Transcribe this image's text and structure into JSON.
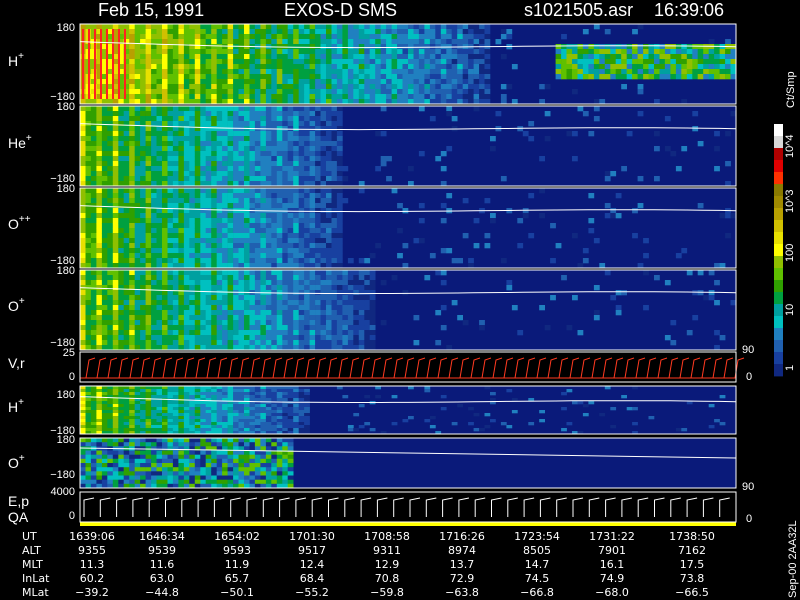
{
  "header": {
    "date": "Feb 15, 1991",
    "mission": "EXOS-D SMS",
    "file": "s1021505.asr",
    "time": "16:39:06"
  },
  "colorbar": {
    "unit": "Ct/Smp",
    "tick_labels": [
      "10^4",
      "10^3",
      "100",
      "10",
      "1"
    ],
    "colors": [
      "#ffffff",
      "#d8d8d8",
      "#b00000",
      "#e00000",
      "#ff3000",
      "#8a7a00",
      "#a08a00",
      "#b8a000",
      "#d0c000",
      "#e8e000",
      "#ffff00",
      "#90c000",
      "#60c000",
      "#30a000",
      "#00a040",
      "#00a0a0",
      "#00c0c0",
      "#2080c0",
      "#2060b0",
      "#1840a0",
      "#102880"
    ]
  },
  "panels": {
    "h_plus_1": {
      "label": "H",
      "sup": "+",
      "ymax": "180",
      "ymin": "−180"
    },
    "he_plus": {
      "label": "He",
      "sup": "+",
      "ymax": "180",
      "ymin": "−180"
    },
    "o_pp": {
      "label": "O",
      "sup": "++",
      "ymax": "180",
      "ymin": "−180"
    },
    "o_plus_1": {
      "label": "O",
      "sup": "+",
      "ymax": "180",
      "ymin": "−180",
      "right_tick": "90"
    },
    "vr": {
      "label": "V,r",
      "ymax": "25",
      "ymin": "0",
      "right_tick": "0"
    },
    "h_plus_2": {
      "label": "H",
      "sup": "+",
      "ymax": "180",
      "ymin": "−180"
    },
    "o_plus_2": {
      "label": "O",
      "sup": "+",
      "ymax": "180",
      "ymin": "−180",
      "right_tick": "90"
    },
    "ep": {
      "label": "E,p",
      "ymax": "4000",
      "ymin": "0",
      "right_tick": "0"
    },
    "qa": {
      "label": "QA"
    }
  },
  "table": {
    "row_labels": [
      "UT",
      "ALT",
      "MLT",
      "InLat",
      "MLat"
    ],
    "columns": [
      [
        "1639:06",
        "9355",
        "11.3",
        "60.2",
        "−39.2"
      ],
      [
        "1646:34",
        "9539",
        "11.6",
        "63.0",
        "−44.8"
      ],
      [
        "1654:02",
        "9593",
        "11.9",
        "65.7",
        "−50.1"
      ],
      [
        "1701:30",
        "9517",
        "12.4",
        "68.4",
        "−55.2"
      ],
      [
        "1708:58",
        "9311",
        "12.9",
        "70.8",
        "−59.8"
      ],
      [
        "1716:26",
        "8974",
        "13.7",
        "72.9",
        "−63.8"
      ],
      [
        "1723:54",
        "8505",
        "14.7",
        "74.5",
        "−66.8"
      ],
      [
        "1731:22",
        "7901",
        "16.1",
        "74.9",
        "−68.0"
      ],
      [
        "1738:50",
        "7162",
        "17.5",
        "73.8",
        "−66.5"
      ]
    ]
  },
  "footer_stamp": "Sep-00  2AA32L",
  "chart_data": {
    "type": "heatmap",
    "title": "Feb 15, 1991   EXOS-D SMS",
    "x": [
      "1639:06",
      "1646:34",
      "1654:02",
      "1701:30",
      "1708:58",
      "1716:26",
      "1723:54",
      "1731:22",
      "1738:50"
    ],
    "series": [
      {
        "name": "H+",
        "ylim": [
          -180,
          180
        ]
      },
      {
        "name": "He+",
        "ylim": [
          -180,
          180
        ]
      },
      {
        "name": "O++",
        "ylim": [
          -180,
          180
        ]
      },
      {
        "name": "O+",
        "ylim": [
          -180,
          180
        ]
      },
      {
        "name": "V,r",
        "ylim": [
          0,
          25
        ]
      },
      {
        "name": "H+",
        "ylim": [
          -180,
          180
        ]
      },
      {
        "name": "O+",
        "ylim": [
          -180,
          180
        ]
      },
      {
        "name": "E,p",
        "ylim": [
          0,
          4000
        ]
      }
    ],
    "colorbar_label": "Ct/Smp",
    "colorbar_ticks": [
      "1",
      "10",
      "100",
      "10^3",
      "10^4"
    ]
  }
}
